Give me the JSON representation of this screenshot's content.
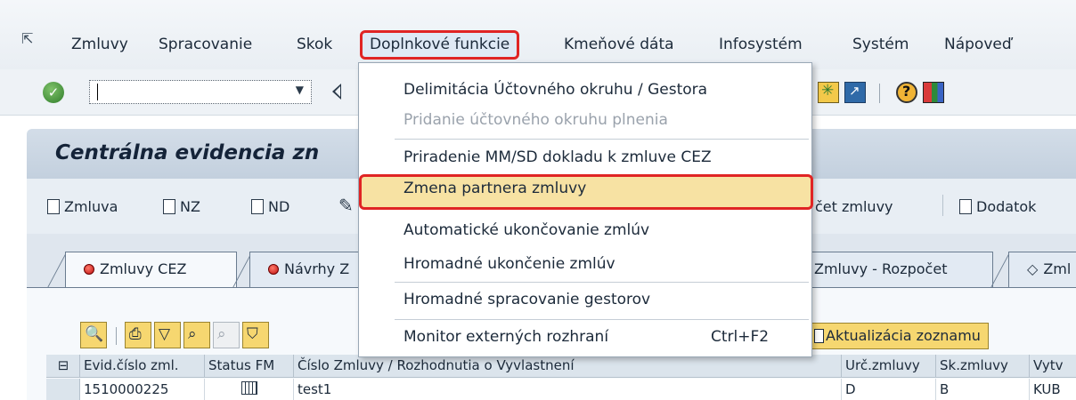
{
  "menubar": {
    "items": [
      "Zmluvy",
      "Spracovanie",
      "Skok",
      "Doplnkové funkcie",
      "Kmeňové dáta",
      "Infosystém",
      "Systém",
      "Nápoveď"
    ],
    "active_index": 3
  },
  "toolbar": {
    "command_value": "",
    "icons": [
      "enter-icon",
      "back-icon",
      "new-session-icon",
      "shortcut-icon",
      "help-icon",
      "layout-icon"
    ]
  },
  "title": "Centrálna evidencia zn",
  "app_toolbar": {
    "buttons": [
      "Zmluva",
      "NZ",
      "ND",
      "čet zmluvy",
      "Dodatok"
    ]
  },
  "tabs": [
    "Zmluvy CEZ",
    "Návrhy Z",
    "Zmluvy - Rozpočet",
    "Zml"
  ],
  "alv": {
    "refresh_label": "Aktualizácia zoznamu",
    "icons": [
      "details-icon",
      "print-icon",
      "filter-icon",
      "find-icon",
      "find-next-icon",
      "funnel-icon"
    ]
  },
  "grid": {
    "columns": [
      "Evid.číslo zml.",
      "Status FM",
      "Číslo Zmluvy / Rozhodnutia o Vyvlastnení",
      "Urč.zmluvy",
      "Sk.zmluvy",
      "Vytv"
    ],
    "rows": [
      [
        "1510000225",
        "",
        "test1",
        "D",
        "B",
        "KUB"
      ]
    ]
  },
  "dropdown": {
    "items": [
      {
        "label": "Delimitácia Účtovného okruhu / Gestora",
        "disabled": false,
        "shortcut": ""
      },
      {
        "label": "Pridanie účtovného okruhu plnenia",
        "disabled": true,
        "shortcut": ""
      },
      {
        "label": "Priradenie MM/SD dokladu k zmluve CEZ",
        "disabled": false,
        "shortcut": ""
      },
      {
        "label": "Zmena partnera zmluvy",
        "disabled": false,
        "shortcut": "",
        "highlighted": true
      },
      {
        "label": "Automatické ukončovanie zmlúv",
        "disabled": false,
        "shortcut": ""
      },
      {
        "label": "Hromadné ukončenie zmlúv",
        "disabled": false,
        "shortcut": ""
      },
      {
        "label": "Hromadné spracovanie gestorov",
        "disabled": false,
        "shortcut": ""
      },
      {
        "label": "Monitor externých rozhraní",
        "disabled": false,
        "shortcut": "Ctrl+F2"
      }
    ]
  },
  "colors": {
    "highlight_border": "#e02424",
    "highlight_fill": "#f7e2a3",
    "title_band": "#c8d4e1"
  }
}
